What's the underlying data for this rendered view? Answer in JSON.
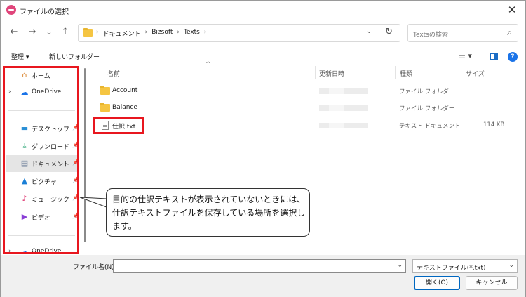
{
  "window": {
    "title": "ファイルの選択",
    "close_glyph": "✕"
  },
  "nav": {
    "back_glyph": "←",
    "forward_glyph": "→",
    "recent_glyph": "⌄",
    "up_glyph": "↑"
  },
  "address": {
    "crumbs": [
      "ドキュメント",
      "Bizsoft",
      "Texts"
    ],
    "separator": "›",
    "dropdown_glyph": "⌄",
    "refresh_glyph": "↻"
  },
  "search": {
    "placeholder": "Textsの検索",
    "icon_glyph": "⌕"
  },
  "commandbar": {
    "organize": "整理 ▾",
    "new_folder": "新しいフォルダー",
    "view_glyph": "☰ ▾",
    "help_glyph": "?"
  },
  "sidebar": {
    "items": [
      {
        "label": "ホーム",
        "icon": "home-icon",
        "glyph": "⌂",
        "color": "#d9822b"
      },
      {
        "label": "OneDrive",
        "icon": "cloud-icon",
        "glyph": "☁",
        "color": "#1a73e8",
        "chevron": "›"
      },
      {
        "label": "デスクトップ",
        "icon": "desktop-icon",
        "glyph": "▬",
        "color": "#2a8fd6",
        "pin": "📌"
      },
      {
        "label": "ダウンロード",
        "icon": "download-icon",
        "glyph": "⤓",
        "color": "#1a9e6a",
        "pin": "📌"
      },
      {
        "label": "ドキュメント",
        "icon": "document-icon",
        "glyph": "▤",
        "color": "#6d7f99",
        "pin": "📌"
      },
      {
        "label": "ピクチャ",
        "icon": "pictures-icon",
        "glyph": "▲",
        "color": "#1a7fd6",
        "pin": "📌"
      },
      {
        "label": "ミュージック",
        "icon": "music-icon",
        "glyph": "♪",
        "color": "#e0457b",
        "pin": "📌"
      },
      {
        "label": "ビデオ",
        "icon": "video-icon",
        "glyph": "▶",
        "color": "#8a3fd6",
        "pin": "📌"
      },
      {
        "label": "OneDrive",
        "icon": "cloud-icon",
        "glyph": "☁",
        "color": "#1a73e8",
        "chevron": "›"
      }
    ],
    "selected": "ドキュメント"
  },
  "columns": {
    "name": "名前",
    "date": "更新日時",
    "type": "種類",
    "size": "サイズ",
    "sort_glyph": "^"
  },
  "files": [
    {
      "name": "Account",
      "type": "ファイル フォルダー",
      "size": "",
      "kind": "folder"
    },
    {
      "name": "Balance",
      "type": "ファイル フォルダー",
      "size": "",
      "kind": "folder"
    },
    {
      "name": "仕訳.txt",
      "type": "テキスト ドキュメント",
      "size": "114 KB",
      "kind": "txt"
    }
  ],
  "callout": {
    "text": "目的の仕訳テキストが表示されていないときには、仕訳テキストファイルを保存している場所を選択します。"
  },
  "footer": {
    "filename_label": "ファイル名(N):",
    "filename_value": "",
    "filter_value": "テキストファイル(*.txt)",
    "dropdown_glyph": "⌄",
    "open_button": "開く(O)",
    "cancel_button": "キャンセル"
  },
  "colors": {
    "highlight_box": "#e8171f",
    "accent": "#0067c0"
  }
}
